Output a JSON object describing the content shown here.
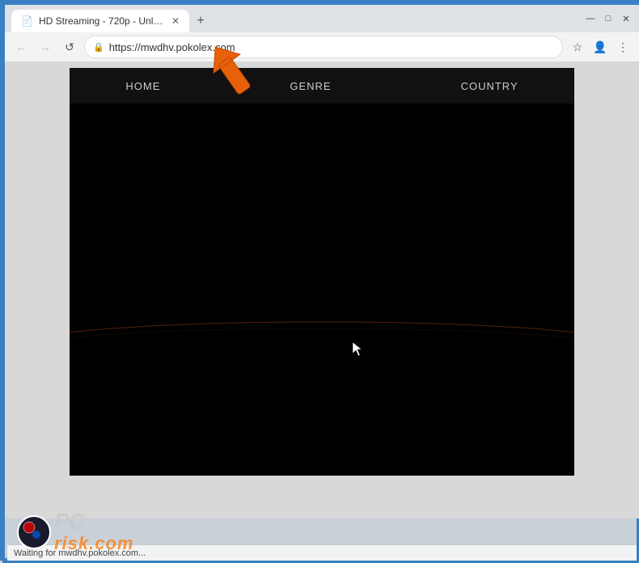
{
  "browser": {
    "border_color": "#3a7fc1",
    "tab": {
      "title": "HD Streaming - 720p - Unlim...",
      "favicon": "📄"
    },
    "new_tab_label": "+",
    "address_bar": {
      "url": "https://mwdhv.pokolex.com",
      "lock_icon": "🔒"
    },
    "nav": {
      "back_btn": "←",
      "forward_btn": "→",
      "refresh_btn": "↺",
      "star_btn": "☆",
      "account_btn": "👤",
      "menu_btn": "⋮"
    },
    "window_controls": {
      "minimize": "—",
      "maximize": "□",
      "close": "✕"
    }
  },
  "website": {
    "nav": {
      "items": [
        {
          "label": "HOME"
        },
        {
          "label": "GENRE"
        },
        {
          "label": "COUNTRY"
        }
      ]
    },
    "video": {
      "bg_color": "#000000"
    }
  },
  "watermark": {
    "pc_text": "PC",
    "risk_text": "risk.com"
  },
  "status_bar": {
    "text": "Waiting for mwdhv.pokolex.com..."
  },
  "annotation": {
    "arrow_color": "#e8610a"
  }
}
